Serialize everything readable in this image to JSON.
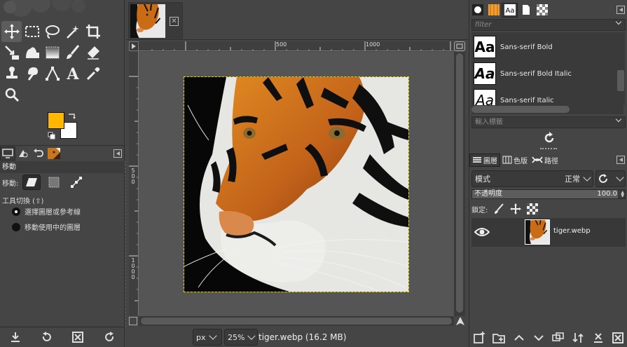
{
  "toolbox": {
    "tools": [
      {
        "name": "move-tool-icon",
        "active": true
      },
      {
        "name": "rect-select-icon"
      },
      {
        "name": "free-select-icon"
      },
      {
        "name": "fuzzy-select-icon"
      },
      {
        "name": "crop-icon"
      },
      {
        "name": "blank"
      },
      {
        "name": "unified-transform-icon"
      },
      {
        "name": "warp-transform-icon"
      },
      {
        "name": "gradient-icon"
      },
      {
        "name": "paintbrush-icon"
      },
      {
        "name": "eraser-icon"
      },
      {
        "name": "blank"
      },
      {
        "name": "clone-icon"
      },
      {
        "name": "smudge-icon"
      },
      {
        "name": "paths-icon"
      },
      {
        "name": "text-tool-icon"
      },
      {
        "name": "color-picker-icon"
      },
      {
        "name": "blank"
      },
      {
        "name": "zoom-icon"
      }
    ],
    "fg_color": "#ffb700",
    "bg_color": "#ffffff"
  },
  "tool_options": {
    "title": "移動",
    "move_label": "移動:",
    "switch_label": "工具切換 (⇧)",
    "radio_pick": "選擇圖層或參考線",
    "radio_active": "移動使用中的圖層"
  },
  "image_window": {
    "ruler_labels": [
      "500",
      "1000",
      "500",
      "1000"
    ],
    "unit": "px",
    "zoom": "25%",
    "status": "tiger.webp (16.2 MB)"
  },
  "fonts": {
    "filter_placeholder": "filter",
    "items": [
      {
        "preview": "Aa",
        "name": "Sans-serif Bold",
        "style": "bold"
      },
      {
        "preview": "Aa",
        "name": "Sans-serif Bold Italic",
        "style": "bolditalic"
      },
      {
        "preview": "Aa",
        "name": "Sans-serif Italic",
        "style": "italic"
      }
    ],
    "tag_placeholder": "輸入標籤"
  },
  "layers": {
    "tab_layers": "圖層",
    "tab_channels": "色版",
    "tab_paths": "路徑",
    "mode_label": "模式",
    "mode_value": "正常",
    "opacity_label": "不透明度",
    "opacity_value": "100.0",
    "lock_label": "鎖定:",
    "layer_name": "tiger.webp"
  },
  "colors": {
    "accent_yellow": "#ffb700",
    "panel_bg": "#454545",
    "canvas_bg": "#555555"
  }
}
